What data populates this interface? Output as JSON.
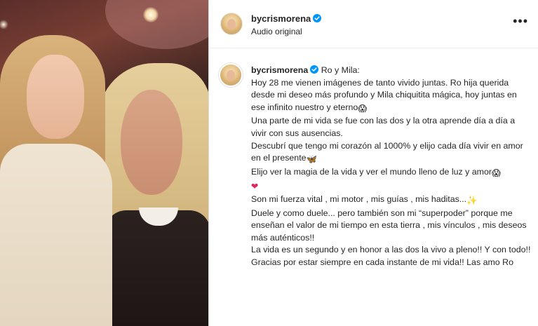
{
  "photo": {
    "alt_icon": "photo-girl-and-woman"
  },
  "post": {
    "username": "bycrismorena",
    "subtitle": "Audio original",
    "more_icon": "more-icon",
    "more_label": "•••"
  },
  "caption": {
    "username": "bycrismorena",
    "first_line": "Ro y Mila:",
    "lines": [
      "Hoy 28 me vienen imágenes de tanto vivido juntas. Ro hija querida desde mi deseo más profundo y Mila chiquitita mágica, hoy juntas en ese infinito nuestro y eterno",
      "Una parte de mi vida se fue con las dos y la otra aprende día a día a vivir con sus ausencias.",
      "Descubrí que tengo mi corazón al 1000% y elijo cada día vivir en amor en el presente",
      "Elijo ver la magia de la vida y ver el mundo lleno de luz y amor",
      "",
      "Son mi fuerza vital , mi motor , mis guías , mis haditas...",
      "Duele y como duele... pero también son mi “superpoder” porque me enseñan el valor de mi tiempo en esta tierra , mis vínculos , mis deseos más auténticos!!",
      "La vida es un segundo y en honor a las dos la vivo a pleno!! Y con todo!!",
      "Gracias por estar siempre en cada instante de mi vida!! Las amo Ro"
    ],
    "emojis": {
      "line1": "😱",
      "line3": "🦋",
      "line4": "😱",
      "line5": "❤",
      "line6": "✨"
    }
  },
  "colors": {
    "verified_blue": "#0095f6",
    "heart_red": "#e0245e",
    "text": "#262626"
  }
}
